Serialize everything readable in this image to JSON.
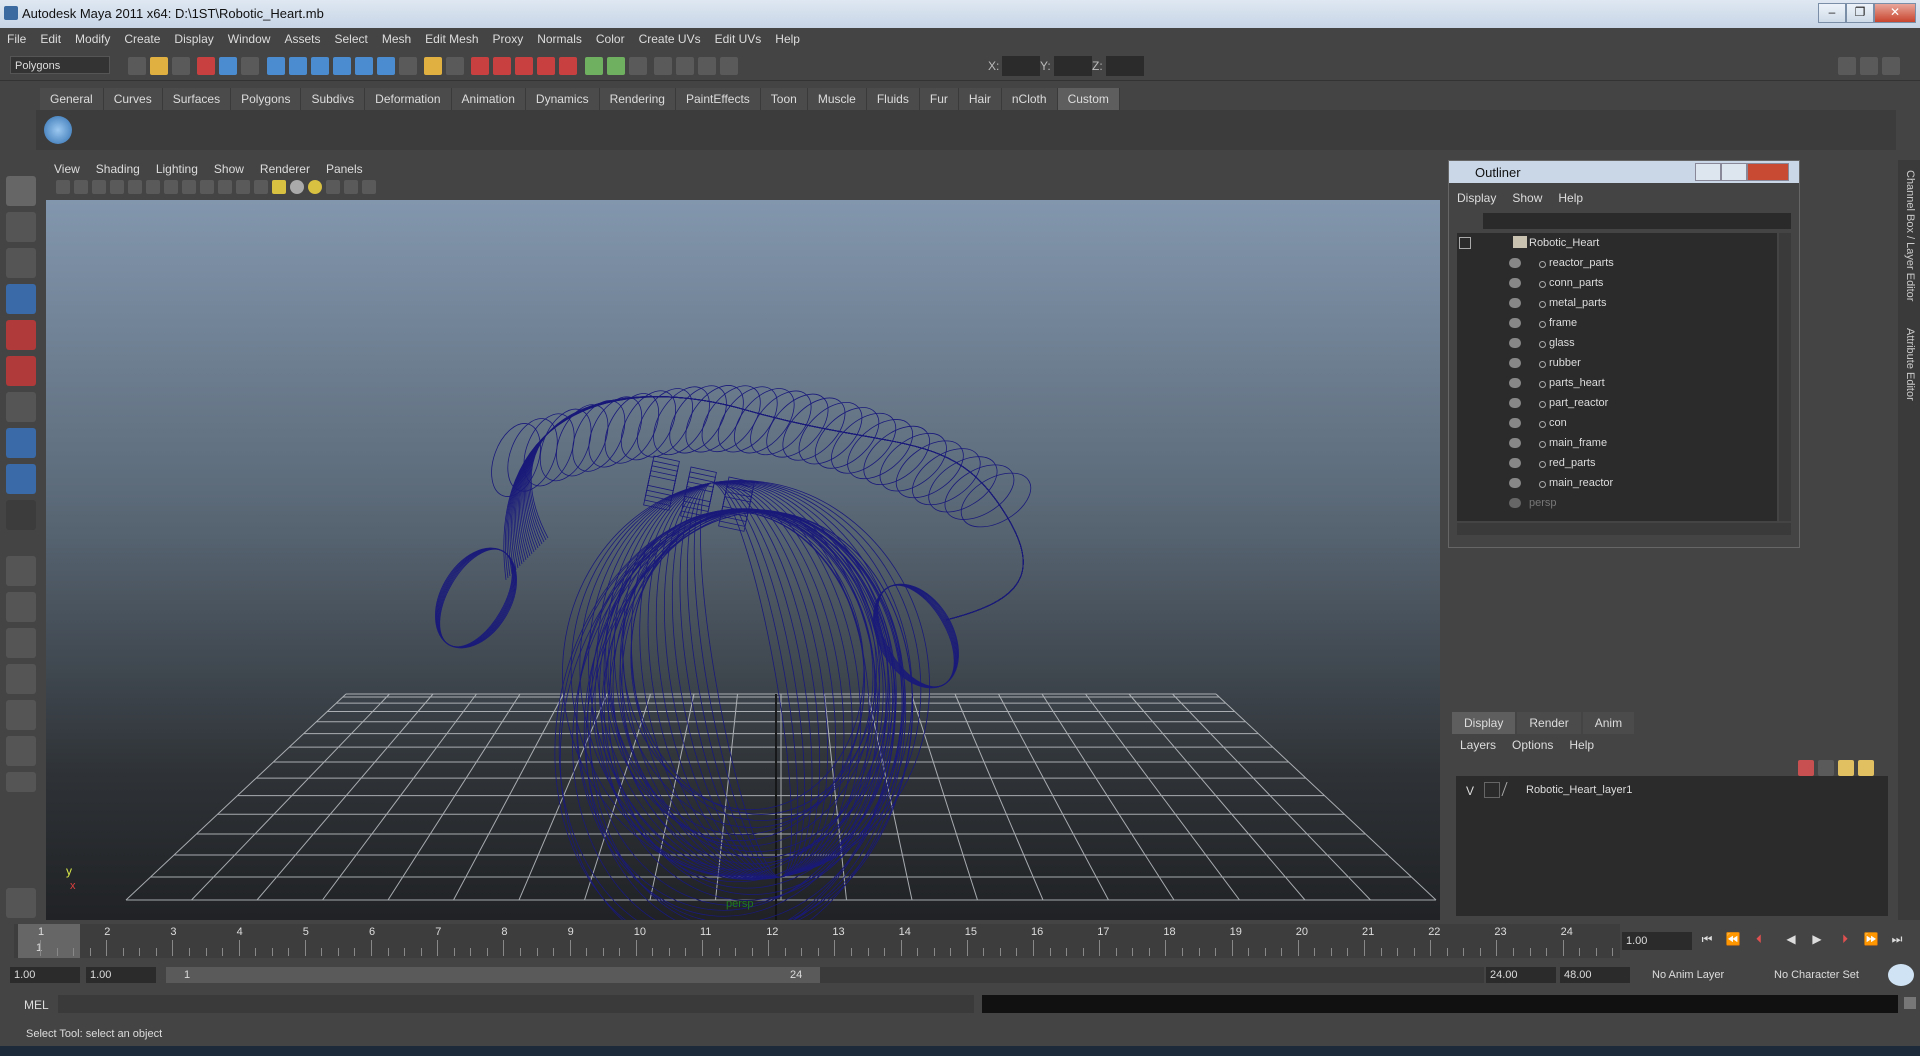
{
  "window": {
    "title": "Autodesk Maya 2011 x64: D:\\1ST\\Robotic_Heart.mb",
    "controls": [
      "–",
      "❐",
      "✕"
    ]
  },
  "menubar": [
    "File",
    "Edit",
    "Modify",
    "Create",
    "Display",
    "Window",
    "Assets",
    "Select",
    "Mesh",
    "Edit Mesh",
    "Proxy",
    "Normals",
    "Color",
    "Create UVs",
    "Edit UVs",
    "Help"
  ],
  "statusline": {
    "mode": "Polygons",
    "coord_labels": {
      "x": "X:",
      "y": "Y:",
      "z": "Z:"
    }
  },
  "shelf_tabs": [
    "General",
    "Curves",
    "Surfaces",
    "Polygons",
    "Subdivs",
    "Deformation",
    "Animation",
    "Dynamics",
    "Rendering",
    "PaintEffects",
    "Toon",
    "Muscle",
    "Fluids",
    "Fur",
    "Hair",
    "nCloth",
    "Custom"
  ],
  "shelf_active": "Custom",
  "viewport": {
    "menu": [
      "View",
      "Shading",
      "Lighting",
      "Show",
      "Renderer",
      "Panels"
    ],
    "camera_label": "persp",
    "axis_y": "y",
    "axis_x": "x",
    "wire_color": "#1a1a7a"
  },
  "outliner": {
    "title": "Outliner",
    "menu": [
      "Display",
      "Show",
      "Help"
    ],
    "root": "Robotic_Heart",
    "children": [
      "reactor_parts",
      "conn_parts",
      "metal_parts",
      "frame",
      "glass",
      "rubber",
      "parts_heart",
      "part_reactor",
      "con",
      "main_frame",
      "red_parts",
      "main_reactor"
    ],
    "camera": "persp"
  },
  "layer_editor": {
    "tabs": [
      "Display",
      "Render",
      "Anim"
    ],
    "menu": [
      "Layers",
      "Options",
      "Help"
    ],
    "layer_visibility": "V",
    "layer_name": "Robotic_Heart_layer1"
  },
  "side_tabs": [
    "Channel Box / Layer Editor",
    "Attribute Editor"
  ],
  "timeline": {
    "ticks": [
      "1",
      "2",
      "3",
      "4",
      "5",
      "6",
      "7",
      "8",
      "9",
      "10",
      "11",
      "12",
      "13",
      "14",
      "15",
      "16",
      "17",
      "18",
      "19",
      "20",
      "21",
      "22",
      "23",
      "24"
    ],
    "current_frame_marker": "1",
    "current_frame": "1.00"
  },
  "range": {
    "start": "1.00",
    "playback_start": "1.00",
    "slider_start": "1",
    "slider_end": "24",
    "playback_end": "24.00",
    "end": "48.00",
    "anim_layer": "No Anim Layer",
    "character_set": "No Character Set"
  },
  "cmdline": {
    "label": "MEL"
  },
  "helpline": "Select Tool: select an object"
}
